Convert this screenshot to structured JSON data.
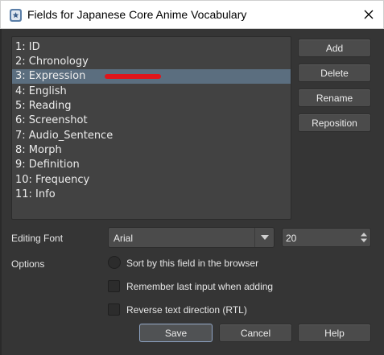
{
  "window": {
    "title": "Fields for Japanese Core Anime Vocabulary",
    "icon": "anki-app-icon",
    "close_glyph": "✕"
  },
  "fields": [
    "1: ID",
    "2: Chronology",
    "3: Expression",
    "4: English",
    "5: Reading",
    "6: Screenshot",
    "7: Audio_Sentence",
    "8: Morph",
    "9: Definition",
    "10: Frequency",
    "11: Info"
  ],
  "selected_field_index": 2,
  "side_buttons": {
    "add": "Add",
    "delete": "Delete",
    "rename": "Rename",
    "reposition": "Reposition"
  },
  "editing_font": {
    "label": "Editing Font",
    "font": "Arial",
    "size": "20"
  },
  "options": {
    "label": "Options",
    "sort_by_field": "Sort by this field in the browser",
    "remember_last_input": "Remember last input when adding",
    "rtl": "Reverse text direction (RTL)"
  },
  "footer": {
    "save": "Save",
    "cancel": "Cancel",
    "help": "Help"
  },
  "colors": {
    "background": "#353535",
    "list_background": "#424242",
    "selection": "#5b6e7f",
    "annotation": "#e0151b",
    "default_button_border": "#8ea4c4"
  }
}
